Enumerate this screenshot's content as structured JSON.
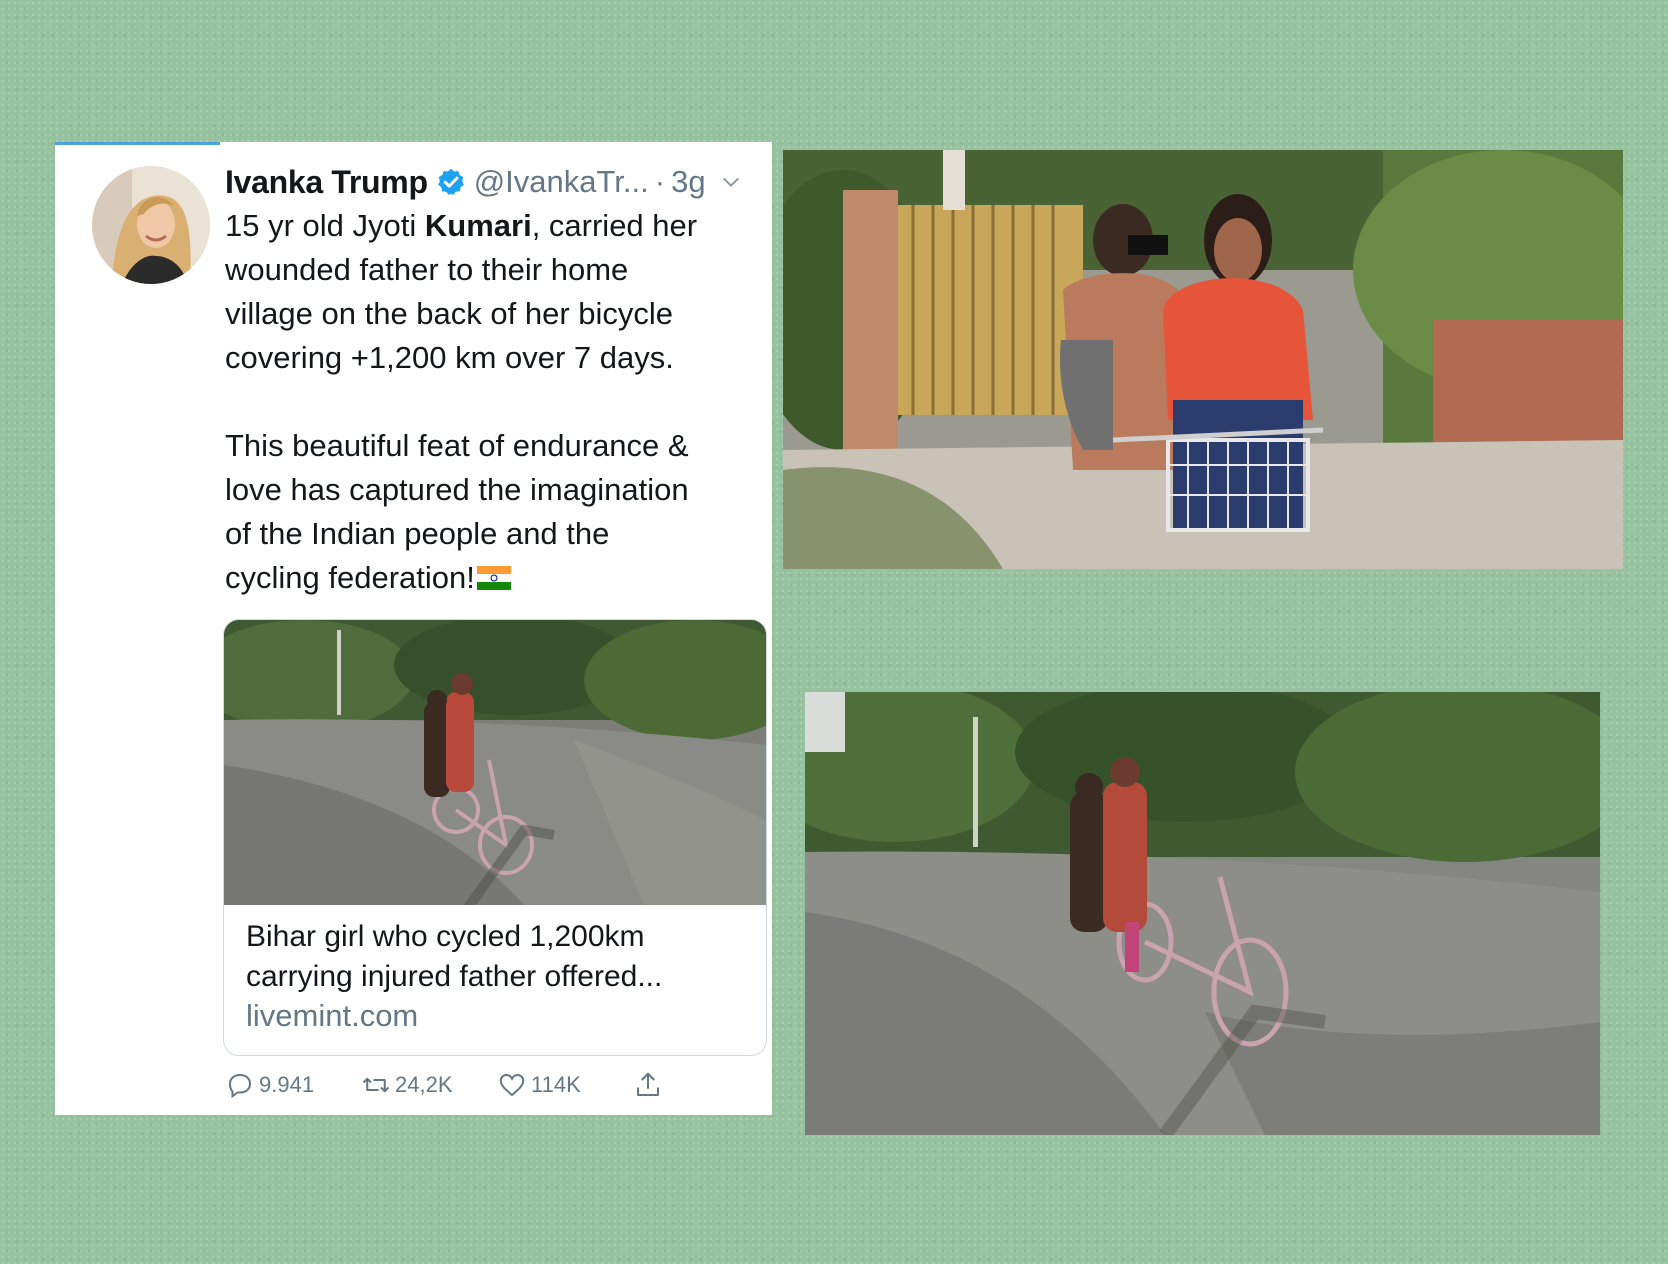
{
  "tweet": {
    "display_name": "Ivanka Trump",
    "handle": "@IvankaTr...",
    "separator": "·",
    "time": "3g",
    "text_lines_p1": [
      "15 yr old Jyoti ",
      "Kumari",
      ", carried her",
      "wounded father to their home",
      "village on the back of her bicycle",
      "covering +1,200 km over 7 days."
    ],
    "text_lines_p2": [
      "This beautiful feat of endurance &",
      "love has captured the imagination",
      "of the Indian people and the",
      "cycling federation!"
    ],
    "link_card": {
      "title_lines": [
        "Bihar girl who cycled 1,200km",
        "carrying injured father offered..."
      ],
      "domain": "livemint.com"
    },
    "actions": {
      "replies": "9.941",
      "retweets": "24,2K",
      "likes": "114K"
    }
  },
  "icons": {
    "verified": "verified-badge-icon",
    "chevron": "chevron-down-icon",
    "reply": "reply-icon",
    "retweet": "retweet-icon",
    "like": "heart-icon",
    "share": "share-icon",
    "flag": "india-flag-emoji"
  },
  "colors": {
    "background": "#97c29f",
    "verified_blue": "#1da1f2",
    "muted_text": "#657786",
    "text": "#14171a"
  }
}
